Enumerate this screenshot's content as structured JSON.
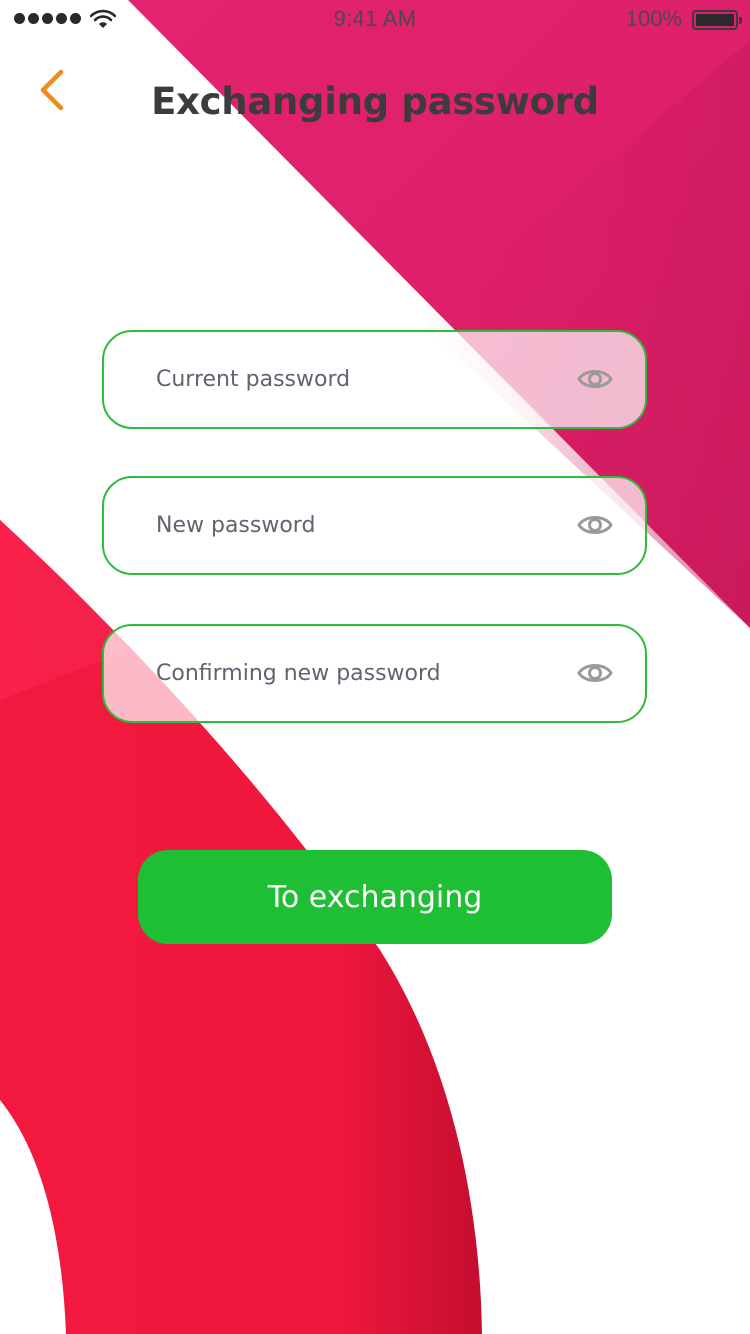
{
  "status_bar": {
    "time": "9:41 AM",
    "battery_percent": "100%",
    "signal_bars": 5
  },
  "header": {
    "back_icon": "chevron-left-icon",
    "title": "Exchanging password"
  },
  "form": {
    "fields": [
      {
        "placeholder": "Current password",
        "value": "",
        "icon": "eye-icon"
      },
      {
        "placeholder": "New password",
        "value": "",
        "icon": "eye-icon"
      },
      {
        "placeholder": "Confirming new password",
        "value": "",
        "icon": "eye-icon"
      }
    ],
    "submit_label": "To exchanging"
  },
  "colors": {
    "accent_back": "#f08a1c",
    "field_border": "#2dbd3a",
    "button": "#1ebe35",
    "title": "#3c3c3c",
    "bg_magenta": "#e0206e",
    "bg_red": "#f0193f"
  }
}
